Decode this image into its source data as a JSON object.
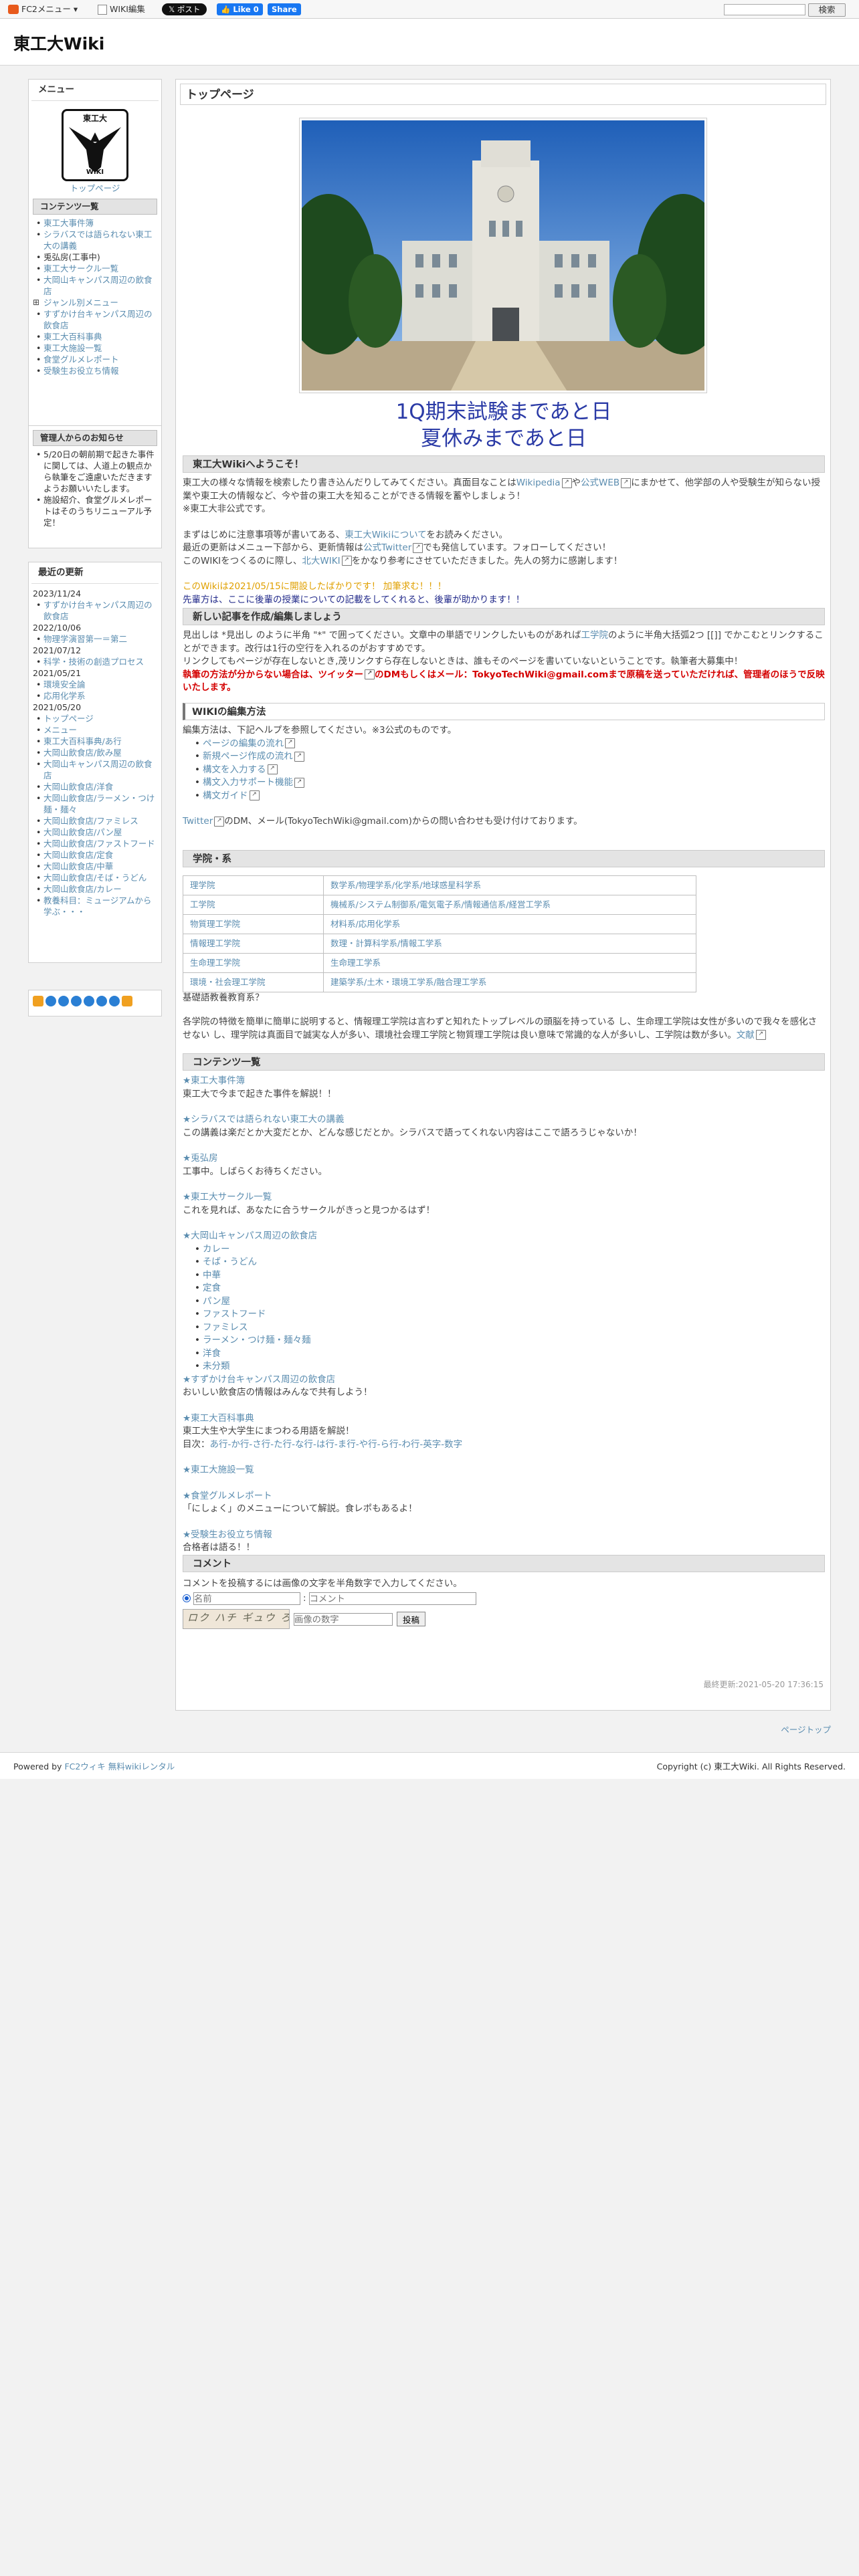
{
  "topbar": {
    "fc2_menu": "FC2メニュー ▾",
    "wiki_edit": "WIKI編集",
    "x_post": "𝕏 ポスト",
    "fb_like": "👍 Like 0",
    "fb_share": "Share",
    "search_button": "検索"
  },
  "header": {
    "site_title": "東工大Wiki"
  },
  "sidebar": {
    "menu": {
      "title": "メニュー",
      "logo_text": "東工大",
      "logo_sub": "WIKI",
      "top_link": "トップページ",
      "contents_title": "コンテンツ一覧",
      "items": [
        {
          "label": "東工大事件簿",
          "kind": "link"
        },
        {
          "label": "シラバスでは語られない東工大の講義",
          "kind": "link"
        },
        {
          "label": "兎弘房(工事中)",
          "kind": "plain"
        },
        {
          "label": "東工大サークル一覧",
          "kind": "link"
        },
        {
          "label": "大岡山キャンパス周辺の飲食店",
          "kind": "link"
        },
        {
          "label": "ジャンル別メニュー",
          "kind": "toggle"
        },
        {
          "label": "すずかけ台キャンパス周辺の飲食店",
          "kind": "link"
        },
        {
          "label": "東工大百科事典",
          "kind": "link"
        },
        {
          "label": "東工大施設一覧",
          "kind": "link"
        },
        {
          "label": "食堂グルメレポート",
          "kind": "link"
        },
        {
          "label": "受験生お役立ち情報",
          "kind": "link"
        }
      ]
    },
    "notice": {
      "title": "管理人からのお知らせ",
      "items": [
        "5/20日の朝前期で起きた事件に関しては、人道上の観点から執筆をご遠慮いただきますようお願いいたします。",
        "施設紹介、食堂グルメレポートはそのうちリニューアル予定！"
      ]
    },
    "updates": {
      "title": "最近の更新",
      "groups": [
        {
          "date": "2023/11/24",
          "items": [
            "すずかけ台キャンパス周辺の飲食店"
          ]
        },
        {
          "date": "2022/10/06",
          "items": [
            "物理学演習第一＝第二"
          ]
        },
        {
          "date": "2021/07/12",
          "items": [
            "科学・技術の創造プロセス"
          ]
        },
        {
          "date": "2021/05/21",
          "items": [
            "環境安全論",
            "応用化学系"
          ]
        },
        {
          "date": "2021/05/20",
          "items": [
            "トップページ",
            "メニュー",
            "東工大百科事典/あ行",
            "大岡山飲食店/飲み屋",
            "大岡山キャンパス周辺の飲食店",
            "大岡山飲食店/洋食",
            "大岡山飲食店/ラーメン・つけ麺・麺々",
            "大岡山飲食店/ファミレス",
            "大岡山飲食店/パン屋",
            "大岡山飲食店/ファストフード",
            "大岡山飲食店/定食",
            "大岡山飲食店/中華",
            "大岡山飲食店/そば・うどん",
            "大岡山飲食店/カレー",
            "教養科目：ミュージアムから学ぶ・・・"
          ]
        }
      ]
    },
    "counter": {
      "digits": "000000"
    }
  },
  "main": {
    "page_title": "トップページ",
    "countdown_line1": "1Q期末試験まであと日",
    "countdown_line2": "夏休みまであと日",
    "welcome": {
      "title": "東工大Wikiへようこそ！",
      "p1a": "東工大の様々な情報を検索したり書き込んだりしてみてください。真面目なことは",
      "wikipedia": "Wikipedia",
      "p1b": "や",
      "official": "公式WEB",
      "p1c": "にまかせて、他学部の人や受験生が知らない授業や東工大の情報など、今や昔の東工大を知ることができる情報を蓄やしましょう！",
      "p2": "※東工大非公式です。",
      "p3a": "まずはじめに注意事項等が書いてある、",
      "about": "東工大Wikiについて",
      "p3b": "をお読みください。",
      "p4a": "最近の更新はメニュー下部から、更新情報は",
      "twitter": "公式Twitter",
      "p4b": "でも発信しています。フォローしてください！",
      "p5a": "このWIKIをつくるのに際し、",
      "kitadai": "北大WIKI",
      "p5b": "をかなり参考にさせていただきました。先人の努力に感謝します！",
      "p6": "このWikiは2021/05/15に開設したばかりです！ 加筆求む！！！",
      "p7": "先輩方は、ここに後輩の授業についての記載をしてくれると、後輩が助かります！！"
    },
    "howto": {
      "title": "新しい記事を作成/編集しましょう",
      "p1a": "見出しは *見出し のように半角 \"*\" で囲ってください。文章中の単語でリンクしたいものがあれば",
      "kogakuin": "工学院",
      "p1b": "のように半角大括弧2つ [[]] でかこむとリンクすることができます。改行は1行の空行を入れるのがおすすめです。",
      "p2": "リンクしてもページが存在しないとき,茂リンクすら存在しないときは、誰もそのページを書いていないということです。執筆者大募集中！",
      "p3": "執筆の方法が分からない場合は、ツイッター",
      "p3b": "のDMもしくはメール：TokyoTechWiki@gmail.comまで原稿を送っていただければ、管理者のほうで反映いたします。"
    },
    "editing": {
      "title": "WIKIの編集方法",
      "intro": "編集方法は、下記ヘルプを参照してください。※3公式のものです。",
      "links": [
        "ページの編集の流れ",
        "新規ページ作成の流れ",
        "構文を入力する",
        "構文入力サポート機能",
        "構文ガイド"
      ],
      "contact_a": "Twitter",
      "contact_b": "のDM、メール(TokyoTechWiki@gmail.com)からの問い合わせも受け付けております。"
    },
    "schools": {
      "title": "学院・系",
      "rows": [
        {
          "school": "理学院",
          "depts": "数学系/物理学系/化学系/地球惑星科学系"
        },
        {
          "school": "工学院",
          "depts": "機械系/システム制御系/電気電子系/情報通信系/経営工学系"
        },
        {
          "school": "物質理工学院",
          "depts": "材料系/応用化学系"
        },
        {
          "school": "情報理工学院",
          "depts": "数理・計算科学系/情報工学系"
        },
        {
          "school": "生命理工学院",
          "depts": "生命理工学系"
        },
        {
          "school": "環境・社会理工学院",
          "depts": "建築学系/土木・環境工学系/融合理工学系"
        }
      ],
      "note": "基礎語教養教育系？",
      "desc_a": "各学院の特徴を簡単に簡単に説明すると、情報理工学院は言わずと知れたトップレベルの頭脳を持っている し、生命理工学院は女性が多いので我々を感化させない し、理学院は真面目で誠実な人が多い、環境社会理工学院と物質理工学院は良い意味で常識的な人が多いし、工学院は数が多い。",
      "desc_link": "文献"
    },
    "contents": {
      "title": "コンテンツ一覧",
      "blocks": [
        {
          "link": "東工大事件簿",
          "text": "東工大で今まで起きた事件を解説！！"
        },
        {
          "link": "シラバスでは語られない東工大の講義",
          "text": "この講義は楽だとか大変だとか、どんな感じだとか。シラバスで語ってくれない内容はここで語ろうじゃないか！"
        },
        {
          "link": "兎弘房",
          "text": "工事中。しばらくお待ちください。"
        },
        {
          "link": "東工大サークル一覧",
          "text": "これを見れば、あなたに合うサークルがきっと見つかるはず！"
        }
      ],
      "ookayama": "大岡山キャンパス周辺の飲食店",
      "genres": [
        "カレー",
        "そば・うどん",
        "中華",
        "定食",
        "パン屋",
        "ファストフード",
        "ファミレス",
        "ラーメン・つけ麺・麺々麺",
        "洋食",
        "未分類"
      ],
      "suzukake": "すずかけ台キャンパス周辺の飲食店",
      "suzukake_text": "おいしい飲食店の情報はみんなで共有しよう！",
      "encyclopedia": "東工大百科事典",
      "encyclopedia_text": "東工大生や大学生にまつわる用語を解説！",
      "index_label": "目次：",
      "index": "あ行-か行-さ行-た行-な行-は行-ま行-や行-ら行-わ行-英字-数字",
      "facilities": "東工大施設一覧",
      "gourmet": "食堂グルメレポート",
      "gourmet_text": "「にしょく」のメニューについて解説。食レポもあるよ！",
      "exam": "受験生お役立ち情報",
      "exam_text": "合格者は語る！！"
    },
    "comment": {
      "title": "コメント",
      "instruction": "コメントを投稿するには画像の文字を半角数字で入力してください。",
      "name_placeholder": "名前",
      "comment_placeholder": "コメント",
      "captcha_placeholder": "画像の数字",
      "captcha_text": "ロク ハチ ギュウ ろ",
      "submit": "投稿"
    },
    "last_modified": "最終更新:2021-05-20 17:36:15"
  },
  "page_top": "ページトップ",
  "footer": {
    "powered": "Powered by",
    "fc2wiki": "FC2ウィキ",
    "rental": "無料wikiレンタル",
    "copyright": "Copyright (c) 東工大Wiki. All Rights Reserved."
  }
}
